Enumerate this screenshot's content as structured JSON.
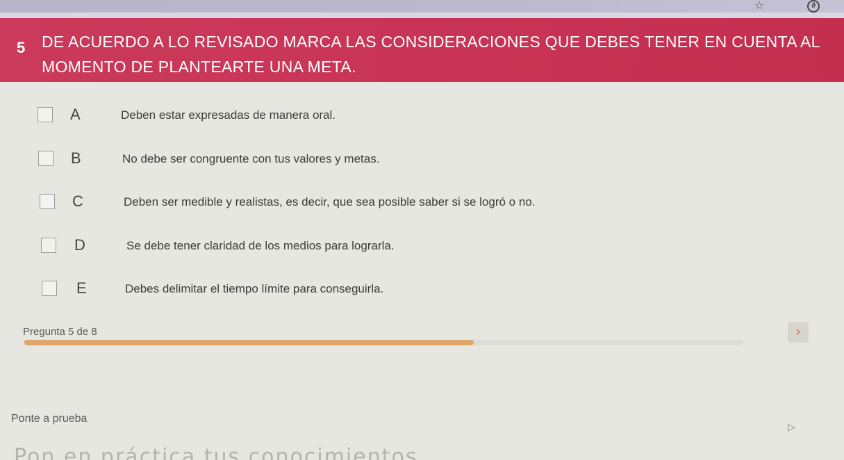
{
  "browser": {
    "star_icon": "star-icon",
    "extension_icon": "extension-icon"
  },
  "question": {
    "number": "5",
    "text": "DE ACUERDO A LO REVISADO MARCA LAS CONSIDERACIONES QUE DEBES TENER EN CUENTA AL MOMENTO DE PLANTEARTE UNA META.",
    "band_color": "#c93456"
  },
  "options": [
    {
      "letter": "A",
      "text": "Deben estar expresadas de manera oral."
    },
    {
      "letter": "B",
      "text": "No debe ser congruente con tus valores y metas."
    },
    {
      "letter": "C",
      "text": "Deben ser medible y realistas, es decir, que sea posible saber si se logró o no."
    },
    {
      "letter": "D",
      "text": "Se debe tener claridad de los medios para lograrla."
    },
    {
      "letter": "E",
      "text": "Debes delimitar el tiempo límite para conseguirla."
    }
  ],
  "progress": {
    "label": "Pregunta 5 de 8",
    "fraction": 0.625,
    "fill_color": "#e0a56a"
  },
  "next_button": {
    "label": "›",
    "icon": "chevron-right-icon"
  },
  "footer": {
    "section_title": "Ponte a prueba",
    "cut_text": "Pon en práctica tus conocimientos"
  }
}
